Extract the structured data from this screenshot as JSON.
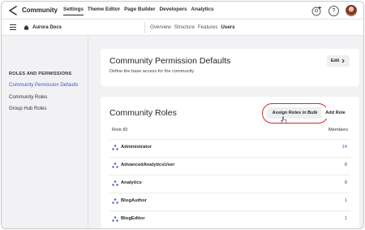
{
  "app": {
    "title": "Community"
  },
  "top_nav": [
    {
      "label": "Settings",
      "active": true
    },
    {
      "label": "Theme Editor",
      "active": false
    },
    {
      "label": "Page Builder",
      "active": false
    },
    {
      "label": "Developers",
      "active": false
    },
    {
      "label": "Analytics",
      "active": false
    }
  ],
  "header_icons": {
    "add_user": "add-user-icon",
    "help": "?",
    "avatar": "user-avatar"
  },
  "breadcrumb": {
    "label": "Aurora Docs",
    "icon": "home-icon"
  },
  "sub_tabs": [
    {
      "label": "Overview",
      "active": false
    },
    {
      "label": "Structure",
      "active": false
    },
    {
      "label": "Features",
      "active": false
    },
    {
      "label": "Users",
      "active": true
    }
  ],
  "sidebar": {
    "heading": "ROLES AND PERMISSIONS",
    "items": [
      {
        "label": "Community Permission Defaults",
        "active": true
      },
      {
        "label": "Community Roles",
        "active": false
      },
      {
        "label": "Group Hub Roles",
        "active": false
      }
    ]
  },
  "permission_card": {
    "title": "Community Permission Defaults",
    "description": "Define the base access for the community",
    "edit_label": "Edit",
    "edit_icon": "chevron-right-icon"
  },
  "roles_card": {
    "title": "Community Roles",
    "bulk_label": "Assign Roles in Bulk",
    "add_label": "Add Role",
    "col_role": "Role ID",
    "col_members": "Members",
    "rows": [
      {
        "name": "Administrator",
        "members": "14",
        "link": true
      },
      {
        "name": "AdvancedAnalyticsUser",
        "members": "0",
        "link": false
      },
      {
        "name": "Analytics",
        "members": "0",
        "link": false
      },
      {
        "name": "BlogAuthor",
        "members": "1",
        "link": true
      },
      {
        "name": "BlogEditor",
        "members": "1",
        "link": true
      }
    ]
  },
  "colors": {
    "accent": "#3f54c9",
    "highlight_ring": "#d62b2b"
  }
}
